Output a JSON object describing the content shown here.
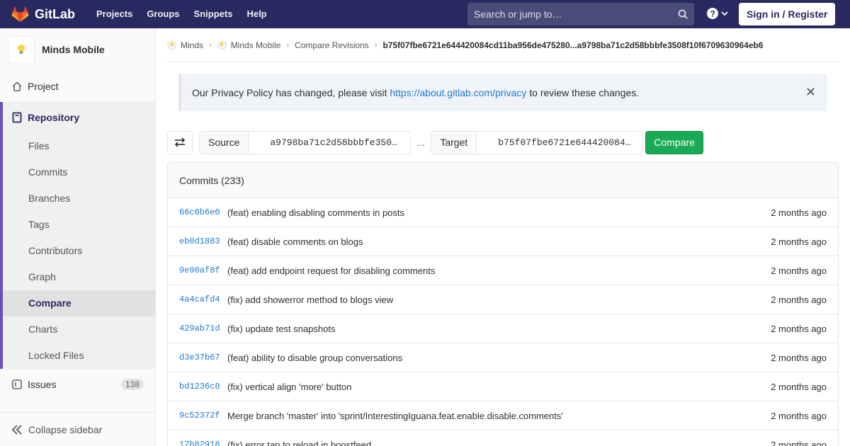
{
  "navbar": {
    "brand": "GitLab",
    "links": [
      "Projects",
      "Groups",
      "Snippets",
      "Help"
    ],
    "search_placeholder": "Search or jump to…",
    "signin": "Sign in / Register"
  },
  "sidebar": {
    "project_name": "Minds Mobile",
    "project": "Project",
    "repository": "Repository",
    "repo_items": [
      "Files",
      "Commits",
      "Branches",
      "Tags",
      "Contributors",
      "Graph",
      "Compare",
      "Charts",
      "Locked Files"
    ],
    "active_item": "Compare",
    "issues": "Issues",
    "issues_count": "138",
    "collapse": "Collapse sidebar"
  },
  "breadcrumbs": {
    "items": [
      "Minds",
      "Minds Mobile",
      "Compare Revisions"
    ],
    "current": "b75f07fbe6721e644420084cd11ba956de475280...a9798ba71c2d58bbbfe3508f10f6709630964eb6"
  },
  "alert": {
    "prefix": "Our Privacy Policy has changed, please visit ",
    "link": "https://about.gitlab.com/privacy",
    "suffix": " to review these changes."
  },
  "compare": {
    "source_label": "Source",
    "source_value": "a9798ba71c2d58bbbfe3508f10f6709630964eb6",
    "dots": "...",
    "target_label": "Target",
    "target_value": "b75f07fbe6721e644420084cd11ba956de475280",
    "button": "Compare"
  },
  "commits": {
    "header": "Commits (233)",
    "rows": [
      {
        "sha": "66c6b6e0",
        "message": "(feat) enabling disabling comments in posts",
        "time": "2 months ago"
      },
      {
        "sha": "eb0d1883",
        "message": "(feat) disable comments on blogs",
        "time": "2 months ago"
      },
      {
        "sha": "9e90af8f",
        "message": "(feat) add endpoint request for disabling comments",
        "time": "2 months ago"
      },
      {
        "sha": "4a4cafd4",
        "message": "(fix) add showerror method to blogs view",
        "time": "2 months ago"
      },
      {
        "sha": "429ab71d",
        "message": "(fix) update test snapshots",
        "time": "2 months ago"
      },
      {
        "sha": "d3e37b67",
        "message": "(feat) ability to disable group conversations",
        "time": "2 months ago"
      },
      {
        "sha": "bd1236c8",
        "message": "(fix) vertical align 'more' button",
        "time": "2 months ago"
      },
      {
        "sha": "9c52372f",
        "message": "Merge branch 'master' into 'sprint/InterestingIguana.feat.enable.disable.comments'",
        "time": "2 months ago"
      },
      {
        "sha": "17b82918",
        "message": "(fix) error tap to reload in boostfeed",
        "time": "2 months ago"
      }
    ]
  },
  "colors": {
    "navbar": "#292961",
    "accent": "#6b4fbb",
    "link": "#1f78d1",
    "compare_button": "#1aaa55"
  }
}
